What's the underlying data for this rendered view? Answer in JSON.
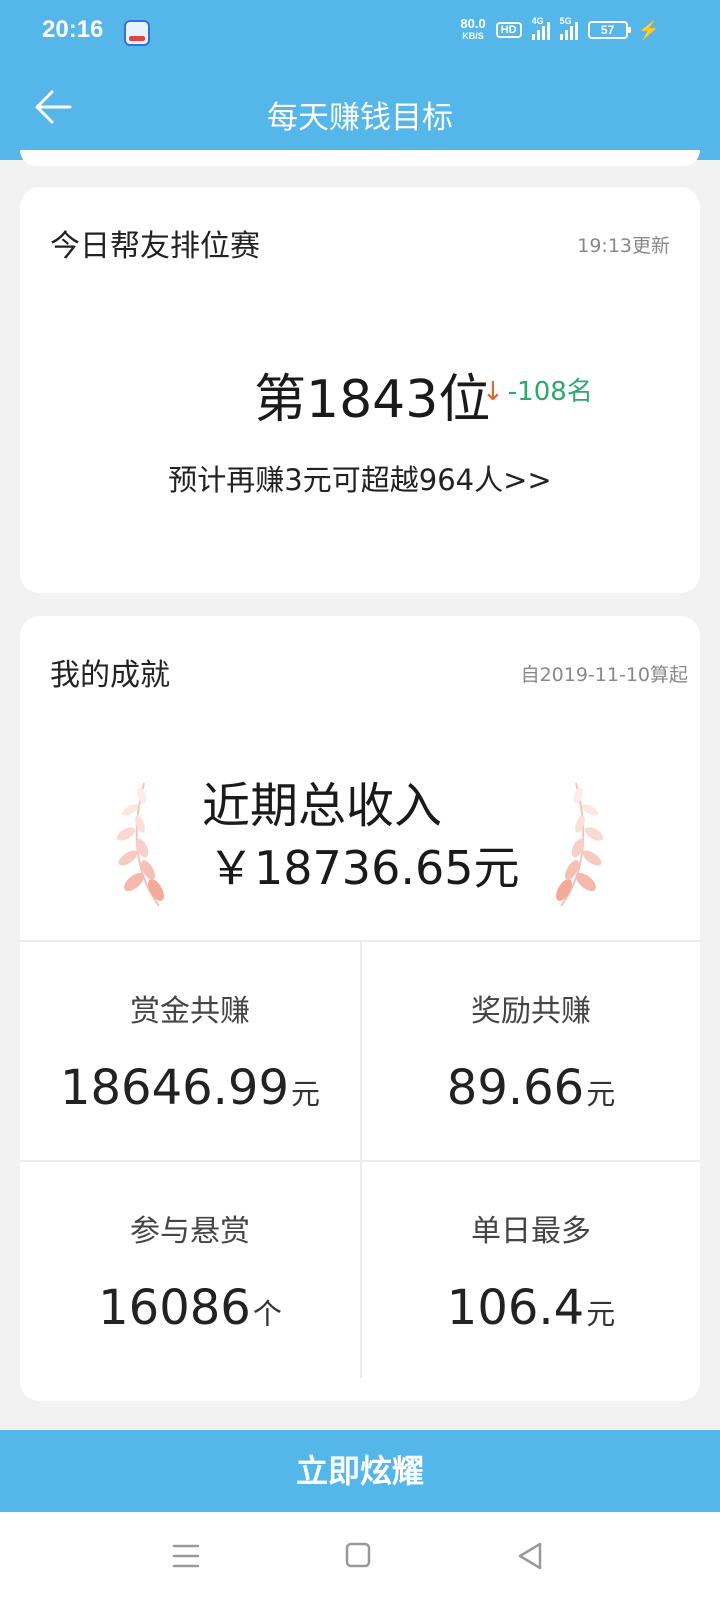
{
  "status": {
    "time": "20:16",
    "net_speed": "80.0",
    "net_unit": "KB/S",
    "hd": "HD",
    "sig1": "4G",
    "sig2": "5G",
    "battery": "57"
  },
  "header": {
    "title": "每天赚钱目标"
  },
  "ranking": {
    "title": "今日帮友排位赛",
    "updated": "19:13更新",
    "rank": "第1843位",
    "change": "-108名",
    "hint": "预计再赚3元可超越964人>>"
  },
  "achievement": {
    "title": "我的成就",
    "since": "自2019-11-10算起",
    "income_label": "近期总收入",
    "income_value": "￥18736.65元",
    "stats": [
      {
        "label": "赏金共赚",
        "value": "18646.99",
        "unit": "元"
      },
      {
        "label": "奖励共赚",
        "value": "89.66",
        "unit": "元"
      },
      {
        "label": "参与悬赏",
        "value": "16086",
        "unit": "个"
      },
      {
        "label": "单日最多",
        "value": "106.4",
        "unit": "元"
      }
    ]
  },
  "cta": {
    "label": "立即炫耀"
  },
  "colors": {
    "primary": "#55b6e9",
    "up": "#2fa86b",
    "down_arrow": "#e8642d",
    "laurel": "#f4b7ad"
  }
}
